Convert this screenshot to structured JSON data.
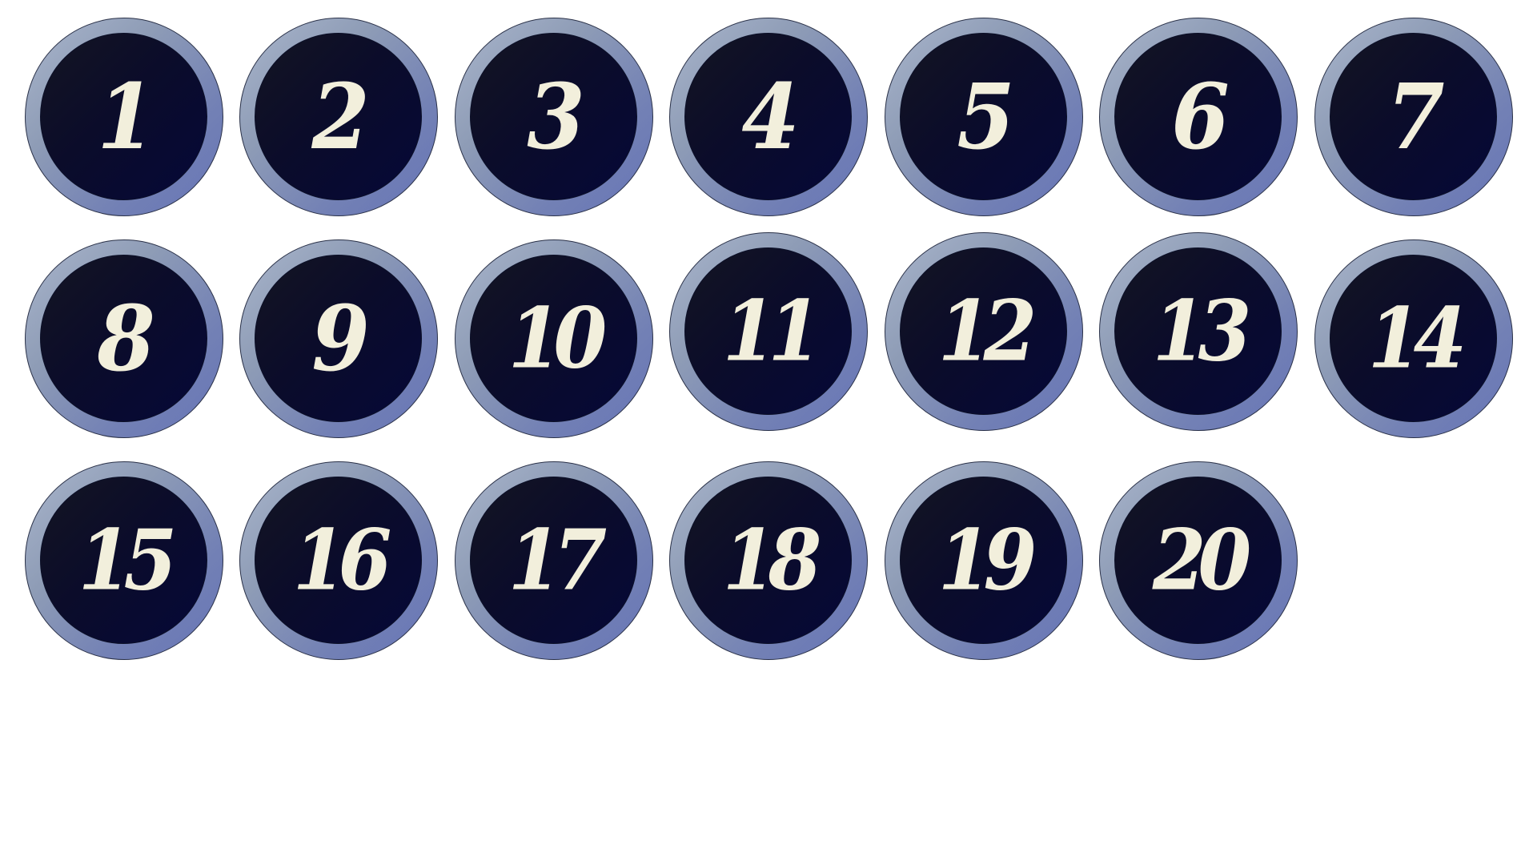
{
  "badges": [
    {
      "number": "1"
    },
    {
      "number": "2"
    },
    {
      "number": "3"
    },
    {
      "number": "4"
    },
    {
      "number": "5"
    },
    {
      "number": "6"
    },
    {
      "number": "7"
    },
    {
      "number": "8"
    },
    {
      "number": "9"
    },
    {
      "number": "10"
    },
    {
      "number": "11"
    },
    {
      "number": "12"
    },
    {
      "number": "13"
    },
    {
      "number": "14"
    },
    {
      "number": "15"
    },
    {
      "number": "16"
    },
    {
      "number": "17"
    },
    {
      "number": "18"
    },
    {
      "number": "19"
    },
    {
      "number": "20"
    }
  ],
  "colors": {
    "ring": "#8e9cb6",
    "ring_dark": "#6674b6",
    "face": "#0b0c2a",
    "numeral": "#f2efdc"
  }
}
